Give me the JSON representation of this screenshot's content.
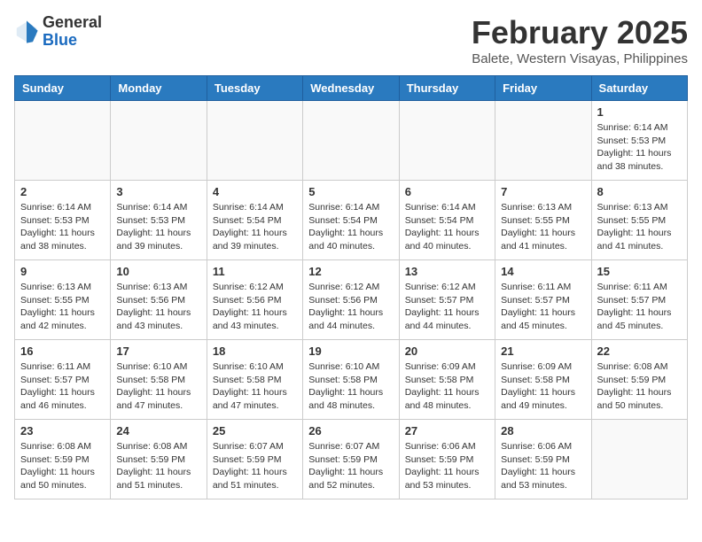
{
  "header": {
    "logo_general": "General",
    "logo_blue": "Blue",
    "month_title": "February 2025",
    "location": "Balete, Western Visayas, Philippines"
  },
  "weekdays": [
    "Sunday",
    "Monday",
    "Tuesday",
    "Wednesday",
    "Thursday",
    "Friday",
    "Saturday"
  ],
  "weeks": [
    [
      {
        "day": "",
        "info": ""
      },
      {
        "day": "",
        "info": ""
      },
      {
        "day": "",
        "info": ""
      },
      {
        "day": "",
        "info": ""
      },
      {
        "day": "",
        "info": ""
      },
      {
        "day": "",
        "info": ""
      },
      {
        "day": "1",
        "info": "Sunrise: 6:14 AM\nSunset: 5:53 PM\nDaylight: 11 hours and 38 minutes."
      }
    ],
    [
      {
        "day": "2",
        "info": "Sunrise: 6:14 AM\nSunset: 5:53 PM\nDaylight: 11 hours and 38 minutes."
      },
      {
        "day": "3",
        "info": "Sunrise: 6:14 AM\nSunset: 5:53 PM\nDaylight: 11 hours and 39 minutes."
      },
      {
        "day": "4",
        "info": "Sunrise: 6:14 AM\nSunset: 5:54 PM\nDaylight: 11 hours and 39 minutes."
      },
      {
        "day": "5",
        "info": "Sunrise: 6:14 AM\nSunset: 5:54 PM\nDaylight: 11 hours and 40 minutes."
      },
      {
        "day": "6",
        "info": "Sunrise: 6:14 AM\nSunset: 5:54 PM\nDaylight: 11 hours and 40 minutes."
      },
      {
        "day": "7",
        "info": "Sunrise: 6:13 AM\nSunset: 5:55 PM\nDaylight: 11 hours and 41 minutes."
      },
      {
        "day": "8",
        "info": "Sunrise: 6:13 AM\nSunset: 5:55 PM\nDaylight: 11 hours and 41 minutes."
      }
    ],
    [
      {
        "day": "9",
        "info": "Sunrise: 6:13 AM\nSunset: 5:55 PM\nDaylight: 11 hours and 42 minutes."
      },
      {
        "day": "10",
        "info": "Sunrise: 6:13 AM\nSunset: 5:56 PM\nDaylight: 11 hours and 43 minutes."
      },
      {
        "day": "11",
        "info": "Sunrise: 6:12 AM\nSunset: 5:56 PM\nDaylight: 11 hours and 43 minutes."
      },
      {
        "day": "12",
        "info": "Sunrise: 6:12 AM\nSunset: 5:56 PM\nDaylight: 11 hours and 44 minutes."
      },
      {
        "day": "13",
        "info": "Sunrise: 6:12 AM\nSunset: 5:57 PM\nDaylight: 11 hours and 44 minutes."
      },
      {
        "day": "14",
        "info": "Sunrise: 6:11 AM\nSunset: 5:57 PM\nDaylight: 11 hours and 45 minutes."
      },
      {
        "day": "15",
        "info": "Sunrise: 6:11 AM\nSunset: 5:57 PM\nDaylight: 11 hours and 45 minutes."
      }
    ],
    [
      {
        "day": "16",
        "info": "Sunrise: 6:11 AM\nSunset: 5:57 PM\nDaylight: 11 hours and 46 minutes."
      },
      {
        "day": "17",
        "info": "Sunrise: 6:10 AM\nSunset: 5:58 PM\nDaylight: 11 hours and 47 minutes."
      },
      {
        "day": "18",
        "info": "Sunrise: 6:10 AM\nSunset: 5:58 PM\nDaylight: 11 hours and 47 minutes."
      },
      {
        "day": "19",
        "info": "Sunrise: 6:10 AM\nSunset: 5:58 PM\nDaylight: 11 hours and 48 minutes."
      },
      {
        "day": "20",
        "info": "Sunrise: 6:09 AM\nSunset: 5:58 PM\nDaylight: 11 hours and 48 minutes."
      },
      {
        "day": "21",
        "info": "Sunrise: 6:09 AM\nSunset: 5:58 PM\nDaylight: 11 hours and 49 minutes."
      },
      {
        "day": "22",
        "info": "Sunrise: 6:08 AM\nSunset: 5:59 PM\nDaylight: 11 hours and 50 minutes."
      }
    ],
    [
      {
        "day": "23",
        "info": "Sunrise: 6:08 AM\nSunset: 5:59 PM\nDaylight: 11 hours and 50 minutes."
      },
      {
        "day": "24",
        "info": "Sunrise: 6:08 AM\nSunset: 5:59 PM\nDaylight: 11 hours and 51 minutes."
      },
      {
        "day": "25",
        "info": "Sunrise: 6:07 AM\nSunset: 5:59 PM\nDaylight: 11 hours and 51 minutes."
      },
      {
        "day": "26",
        "info": "Sunrise: 6:07 AM\nSunset: 5:59 PM\nDaylight: 11 hours and 52 minutes."
      },
      {
        "day": "27",
        "info": "Sunrise: 6:06 AM\nSunset: 5:59 PM\nDaylight: 11 hours and 53 minutes."
      },
      {
        "day": "28",
        "info": "Sunrise: 6:06 AM\nSunset: 5:59 PM\nDaylight: 11 hours and 53 minutes."
      },
      {
        "day": "",
        "info": ""
      }
    ]
  ]
}
